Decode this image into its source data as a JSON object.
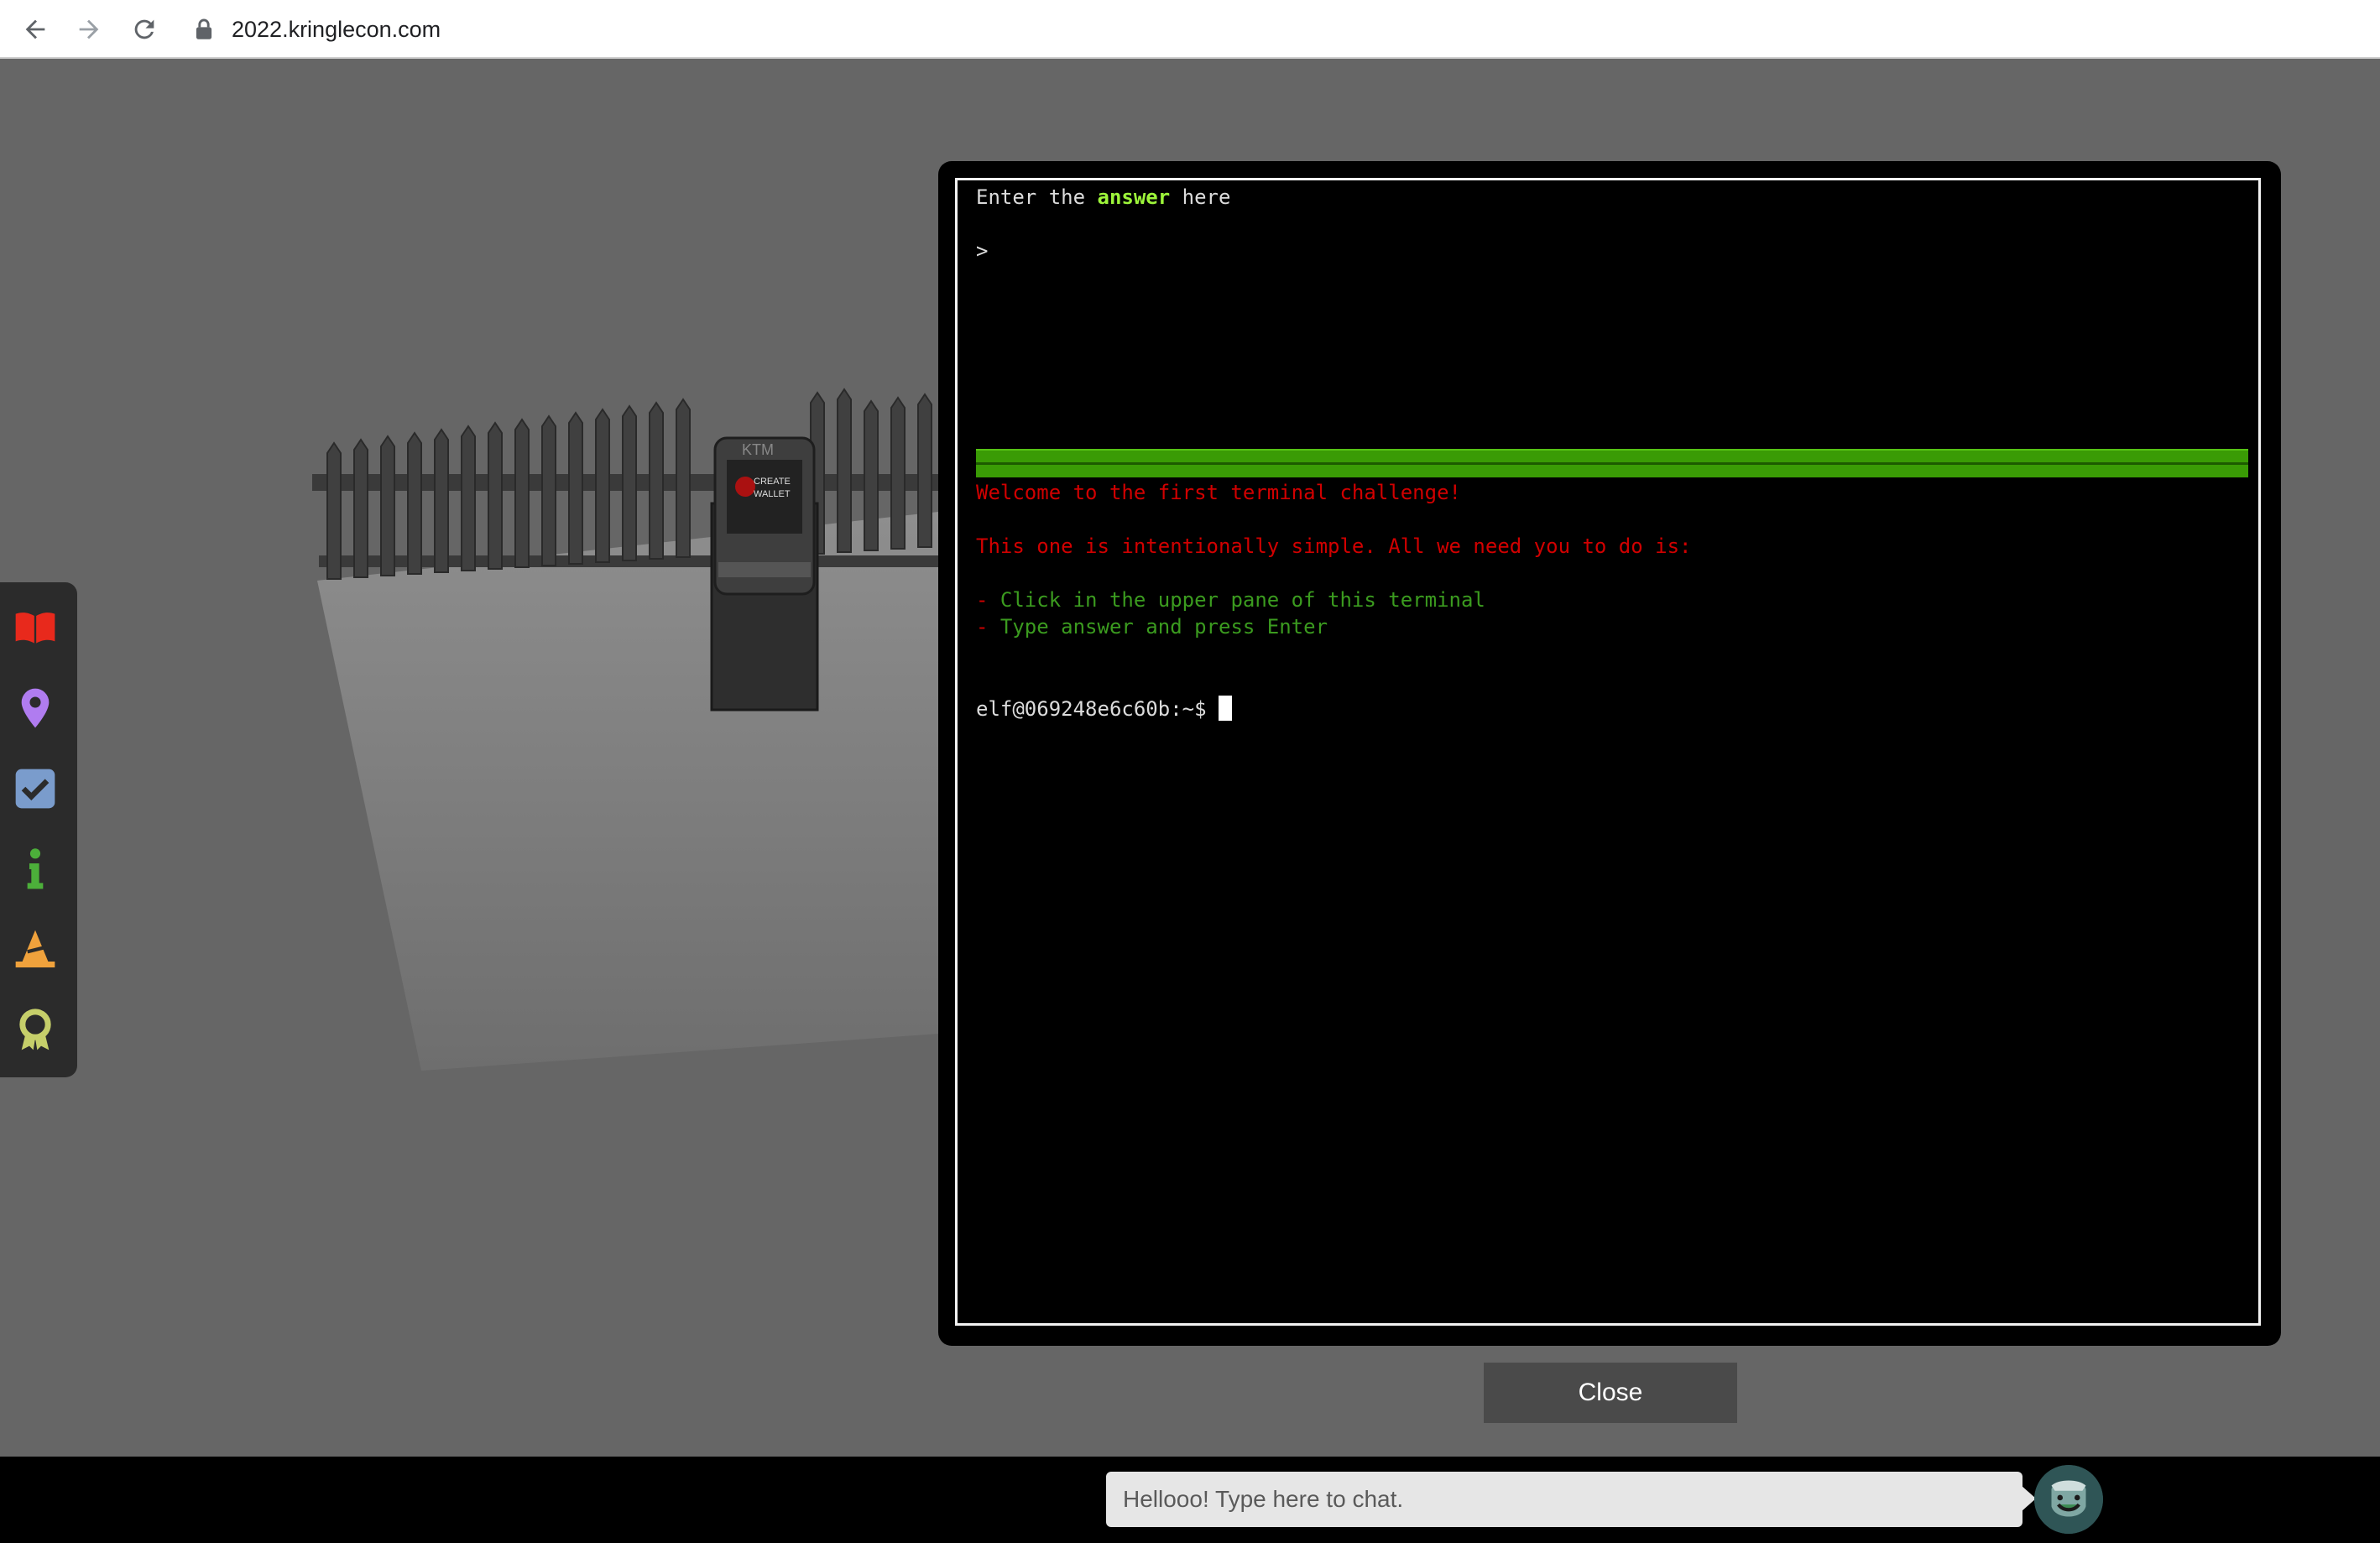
{
  "browser": {
    "url": "2022.kringlecon.com",
    "icons": [
      "back-arrow-icon",
      "forward-arrow-icon",
      "reload-icon",
      "lock-icon"
    ]
  },
  "scene": {
    "kiosk_brand": "KTM",
    "kiosk_label_line1": "CREATE",
    "kiosk_label_line2": "WALLET"
  },
  "side_menu": {
    "items": [
      {
        "name": "badge-book",
        "icon": "book-icon",
        "color": "#e8291c"
      },
      {
        "name": "map",
        "icon": "map-pin-icon",
        "color": "#b07cf0"
      },
      {
        "name": "objectives",
        "icon": "checkbox-icon",
        "color": "#7a9ccc"
      },
      {
        "name": "info",
        "icon": "info-icon",
        "color": "#4caf3a"
      },
      {
        "name": "hats",
        "icon": "wizard-hat-icon",
        "color": "#f0a23c"
      },
      {
        "name": "achievements",
        "icon": "award-ribbon-icon",
        "color": "#c6cf6a"
      }
    ]
  },
  "terminal": {
    "upper": {
      "prompt_prefix": "Enter the ",
      "prompt_keyword": "answer",
      "prompt_suffix": " here",
      "input_caret": ">"
    },
    "lower": {
      "welcome": "Welcome to the first terminal challenge!",
      "intro": "This one is intentionally simple. All we need you to do is:",
      "step1_dash": "-",
      "step1_text": " Click in the upper pane of this terminal",
      "step2_dash": "-",
      "step2_text": " Type answer and press Enter",
      "shell_prompt": "elf@069248e6c60b:~$ "
    },
    "colors": {
      "keyword": "#9df53a",
      "red": "#d10000",
      "green": "#3b9b1f",
      "divider": "#3a9b05"
    }
  },
  "close_button": {
    "label": "Close"
  },
  "chat": {
    "placeholder": "Hellooo! Type here to chat.",
    "avatar": "elf-avatar"
  }
}
